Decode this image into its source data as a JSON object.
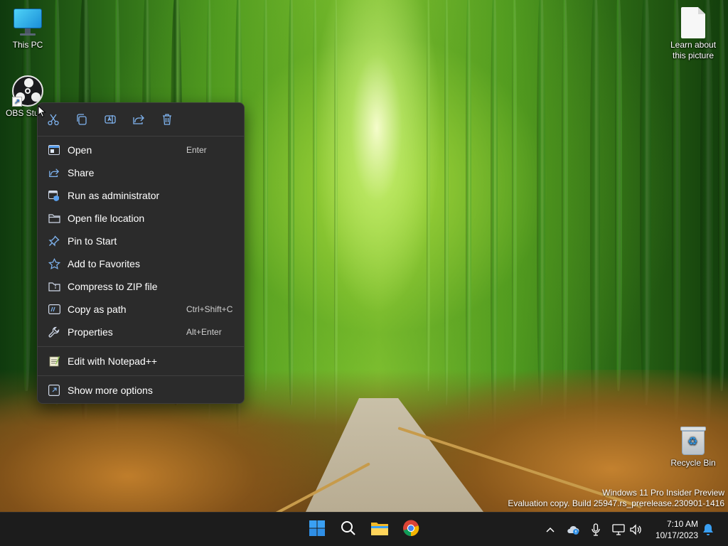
{
  "desktop": {
    "icons": [
      {
        "label": "This PC"
      },
      {
        "label": "OBS Stu"
      },
      {
        "label": "Learn about this picture"
      },
      {
        "label": "Recycle Bin"
      }
    ],
    "watermark": {
      "line1": "Windows 11 Pro Insider Preview",
      "line2": "Evaluation copy. Build 25947.rs_prerelease.230901-1416"
    }
  },
  "context_menu": {
    "quick_actions": [
      "cut-icon",
      "copy-icon",
      "rename-icon",
      "share-icon",
      "delete-icon"
    ],
    "items": [
      {
        "label": "Open",
        "shortcut": "Enter",
        "icon": "open-icon"
      },
      {
        "label": "Share",
        "shortcut": "",
        "icon": "share-icon"
      },
      {
        "label": "Run as administrator",
        "shortcut": "",
        "icon": "run-as-admin-icon"
      },
      {
        "label": "Open file location",
        "shortcut": "",
        "icon": "folder-icon"
      },
      {
        "label": "Pin to Start",
        "shortcut": "",
        "icon": "pin-icon"
      },
      {
        "label": "Add to Favorites",
        "shortcut": "",
        "icon": "star-icon"
      },
      {
        "label": "Compress to ZIP file",
        "shortcut": "",
        "icon": "zip-folder-icon"
      },
      {
        "label": "Copy as path",
        "shortcut": "Ctrl+Shift+C",
        "icon": "copy-path-icon"
      },
      {
        "label": "Properties",
        "shortcut": "Alt+Enter",
        "icon": "wrench-icon"
      },
      {
        "label": "Edit with Notepad++",
        "shortcut": "",
        "icon": "notepad-plus-plus-icon"
      },
      {
        "label": "Show more options",
        "shortcut": "",
        "icon": "more-options-icon"
      }
    ]
  },
  "taskbar": {
    "apps": [
      "start-icon",
      "search-icon",
      "file-explorer-icon",
      "chrome-icon"
    ],
    "tray": [
      "chevron-up-icon",
      "onedrive-icon",
      "microphone-icon",
      "network-icon",
      "volume-icon",
      "notification-bell-icon"
    ],
    "clock": {
      "time": "7:10 AM",
      "date": "10/17/2023"
    }
  },
  "colors": {
    "menu_bg": "#2b2b2b",
    "accent": "#7fb4f0",
    "taskbar_bg": "#1c1c1c"
  }
}
